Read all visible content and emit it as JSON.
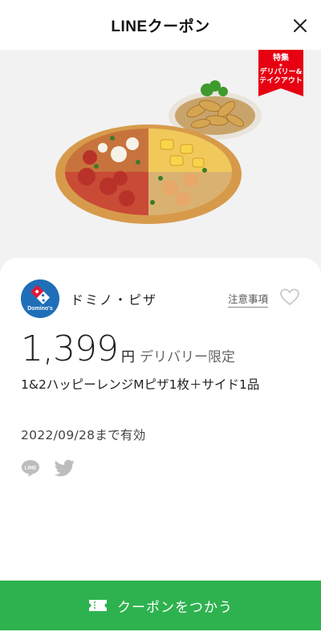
{
  "header": {
    "title": "LINEクーポン",
    "close_icon": "close-icon"
  },
  "hero": {
    "ribbon_line1": "特集",
    "ribbon_star": "★",
    "ribbon_line2": "デリバリー&",
    "ribbon_line3": "テイクアウト",
    "ribbon_color": "#e60012"
  },
  "coupon": {
    "brand_name": "ドミノ・ピザ",
    "logo_text": "Domino's",
    "notice_label": "注意事項",
    "favorite_icon": "heart-icon",
    "price": "1,399",
    "price_unit": "円",
    "price_note": "デリバリー限定",
    "description": "1&2ハッピーレンジMピザ1枚＋サイド1品",
    "expiry": "2022/09/28まで有効",
    "share_icons": [
      "line-icon",
      "twitter-icon"
    ]
  },
  "cta": {
    "label": "クーポンをつかう",
    "icon": "ticket-icon",
    "color": "#2eb24f"
  }
}
